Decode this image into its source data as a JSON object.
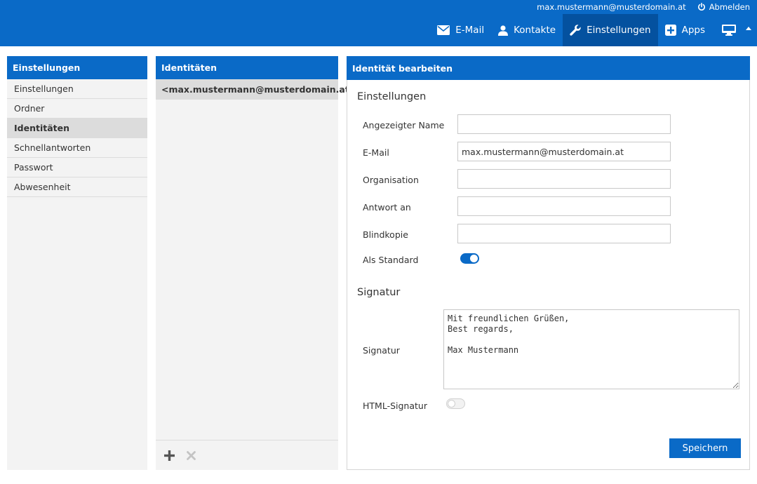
{
  "header": {
    "user_email": "max.mustermann@musterdomain.at",
    "logout_label": "Abmelden",
    "nav": [
      {
        "label": "E-Mail",
        "icon": "envelope-icon"
      },
      {
        "label": "Kontakte",
        "icon": "person-icon"
      },
      {
        "label": "Einstellungen",
        "icon": "wrench-icon",
        "active": true
      },
      {
        "label": "Apps",
        "icon": "plus-square-icon"
      }
    ]
  },
  "settings_panel": {
    "title": "Einstellungen",
    "items": [
      "Einstellungen",
      "Ordner",
      "Identitäten",
      "Schnellantworten",
      "Passwort",
      "Abwesenheit"
    ],
    "selected": "Identitäten"
  },
  "identities_panel": {
    "title": "Identitäten",
    "items": [
      "<max.mustermann@musterdomain.at>"
    ]
  },
  "edit_panel": {
    "title": "Identität bearbeiten",
    "settings_section": "Einstellungen",
    "fields": {
      "display_name": {
        "label": "Angezeigter Name",
        "value": ""
      },
      "email": {
        "label": "E-Mail",
        "value": "max.mustermann@musterdomain.at"
      },
      "organization": {
        "label": "Organisation",
        "value": ""
      },
      "reply_to": {
        "label": "Antwort an",
        "value": ""
      },
      "bcc": {
        "label": "Blindkopie",
        "value": ""
      }
    },
    "default_label": "Als Standard",
    "default_on": true,
    "signature_section": "Signatur",
    "signature_label": "Signatur",
    "signature_text": "Mit freundlichen Grüßen,\nBest regards,\n\nMax Mustermann",
    "html_signature_label": "HTML-Signatur",
    "html_signature_on": false,
    "save_label": "Speichern"
  },
  "colors": {
    "accent": "#0a6ac7",
    "accent_dark": "#04519f",
    "panel_bg": "#f3f3f3",
    "selected_bg": "#dcdcdc"
  }
}
